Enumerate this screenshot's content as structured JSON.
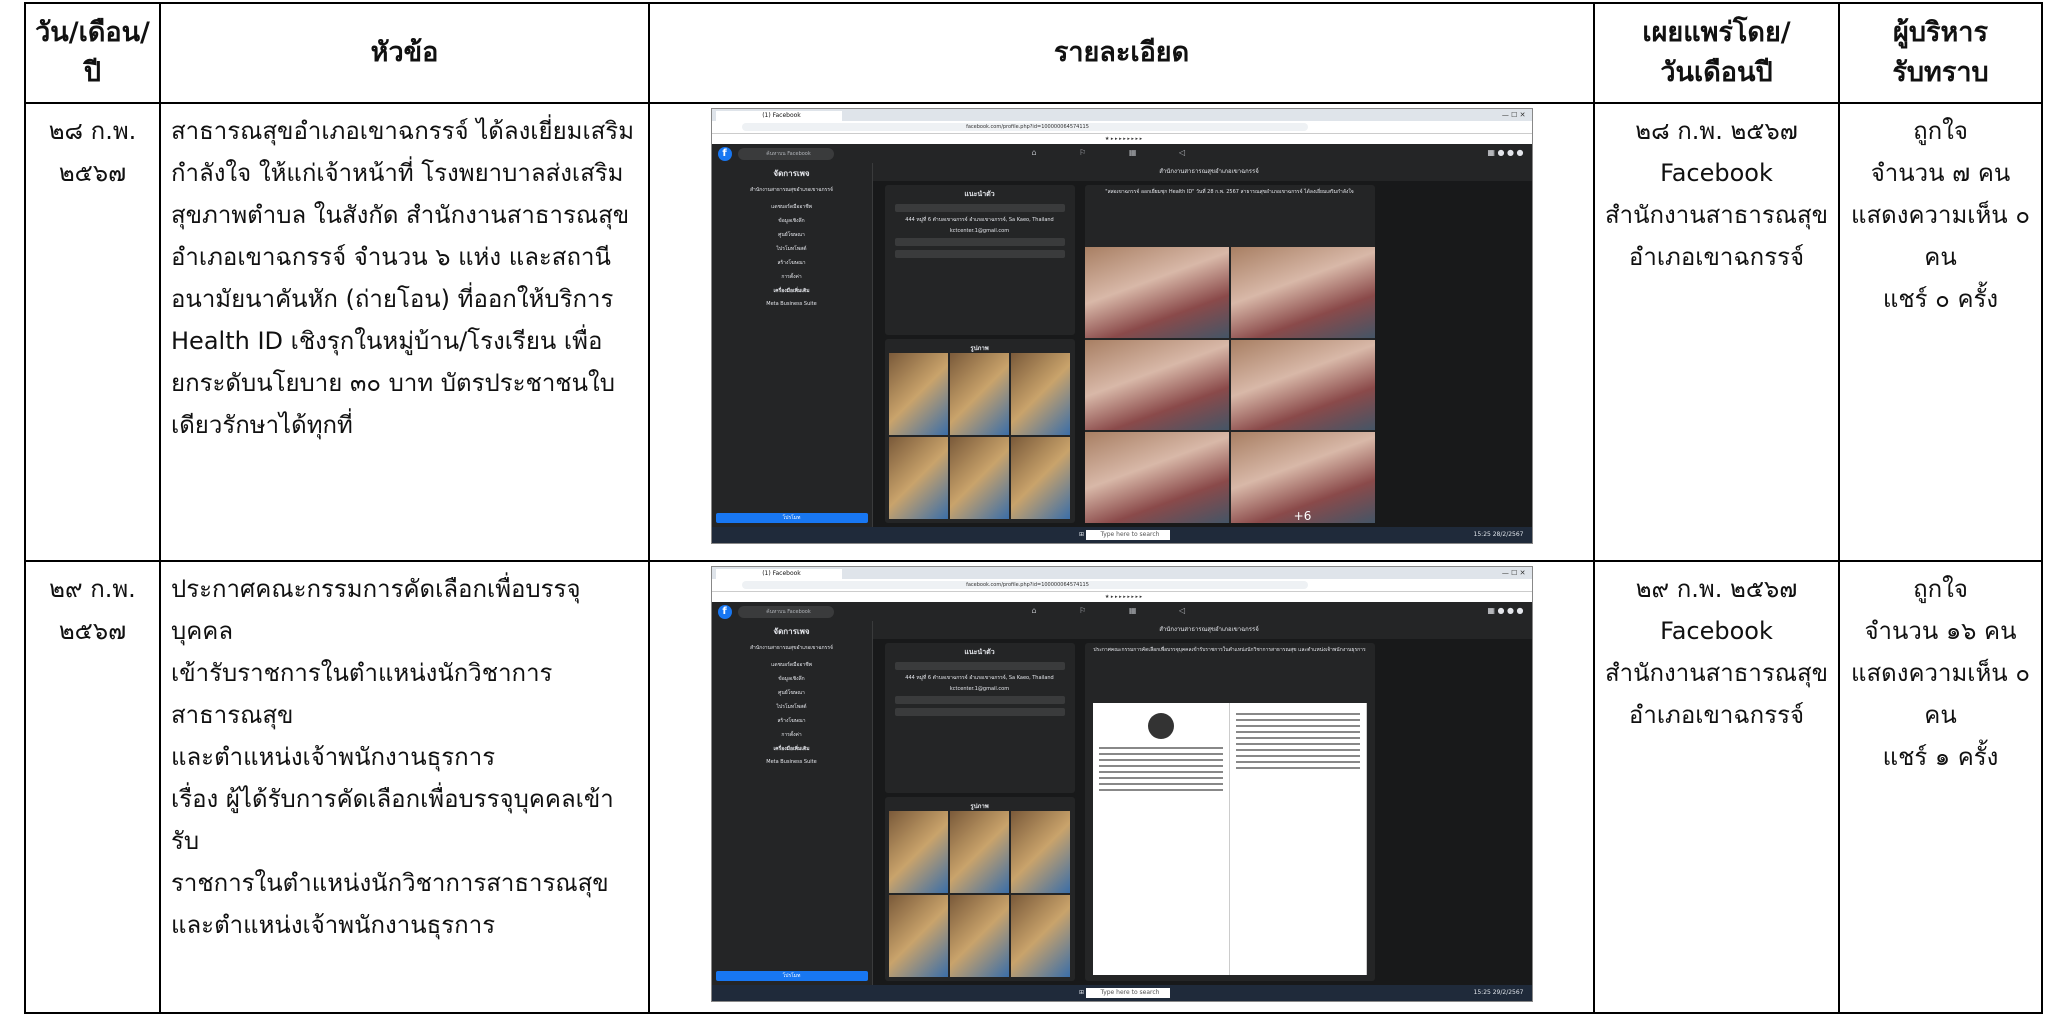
{
  "headers": {
    "date": [
      "วัน/เดือน/",
      "ปี"
    ],
    "topic": "หัวข้อ",
    "detail": "รายละเอียด",
    "publisher": [
      "เผยแพร่โดย/",
      "วันเดือนปี"
    ],
    "exec": [
      "ผู้บริหาร",
      "รับทราบ"
    ]
  },
  "rows": [
    {
      "date": [
        "๒๘ ก.พ.",
        "๒๕๖๗"
      ],
      "topic": [
        "สาธารณสุขอำเภอเขาฉกรรจ์ ได้ลงเยี่ยมเสริม",
        "กำลังใจ ให้แก่เจ้าหน้าที่ โรงพยาบาลส่งเสริม",
        "สุขภาพตำบล ในสังกัด สำนักงานสาธารณสุข",
        "อำเภอเขาฉกรรจ์ จำนวน ๖ แห่ง และสถานี",
        "อนามัยนาคันหัก (ถ่ายโอน) ที่ออกให้บริการ",
        "Health ID  เชิงรุกในหมู่บ้าน/โรงเรียน เพื่อ",
        "ยกระดับนโยบาย ๓๐ บาท บัตรประชาชนใบ",
        "เดียวรักษาได้ทุกที่"
      ],
      "publisher": [
        "๒๘ ก.พ. ๒๕๖๗",
        "Facebook",
        "สำนักงานสาธารณสุข",
        "อำเภอเขาฉกรรจ์"
      ],
      "stats": [
        "ถูกใจ",
        "จำนวน ๗ คน",
        "แสดงความเห็น ๐",
        "คน",
        "แชร์ ๐ ครั้ง"
      ],
      "shot": {
        "tab": "(1) Facebook",
        "url": "facebook.com/profile.php?id=100000064574115",
        "search": "ค้นหาบน Facebook",
        "side_title": "จัดการเพจ",
        "page_name": "สำนักงานสาธารณสุขอำเภอเขาฉกรรจ์",
        "side_items": [
          "แดชบอร์ดมืออาชีพ",
          "ข้อมูลเชิงลึก",
          "ศูนย์โฆษณา",
          "ไปรโมทโพสต์",
          "สร้างโฆษณา",
          "การตั้งค่า"
        ],
        "side_tools": "เครื่องมือเพิ่มเติม",
        "meta_suite": "Meta Business Suite",
        "promote": "โปรโมท",
        "intro_title": "แนะนำตัว",
        "address": "444 หมู่ที่ 6 ตำบลเขาฉกรรจ์ อำเภอเขาฉกรรจ์, Sa Kaeo, Thailand",
        "email": "kctcenter.1@gmail.com",
        "photos_title": "รูปภาพ",
        "post_text": "\"สสอเขาฉกรรจ์ ออกเยี่ยมชุก Health ID\" วันที่ 28 ก.พ. 2567 สาธารณสุขอำเภอเขาฉกรรจ์ ได้ลงเยี่ยมเสริมกำลังใจ",
        "more_count": "+6",
        "taskbar_search": "Type here to search",
        "clock": "15:25 28/2/2567"
      }
    },
    {
      "date": [
        "๒๙ ก.พ.",
        "๒๕๖๗"
      ],
      "topic": [
        "ประกาศคณะกรรมการคัดเลือกเพื่อบรรจุบุคคล",
        "เข้ารับราชการในตำแหน่งนักวิชาการ",
        "สาธารณสุข",
        "และตำแหน่งเจ้าพนักงานธุรการ",
        "เรื่อง ผู้ได้รับการคัดเลือกเพื่อบรรจุบุคคลเข้ารับ",
        "ราชการในตำแหน่งนักวิชาการสาธารณสุข",
        "และตำแหน่งเจ้าพนักงานธุรการ"
      ],
      "publisher": [
        "๒๙ ก.พ. ๒๕๖๗",
        "Facebook",
        "สำนักงานสาธารณสุข",
        "อำเภอเขาฉกรรจ์"
      ],
      "stats": [
        "ถูกใจ",
        "จำนวน ๑๖ คน",
        "แสดงความเห็น ๐",
        "คน",
        "แชร์ ๑ ครั้ง"
      ],
      "shot": {
        "tab": "(1) Facebook",
        "url": "facebook.com/profile.php?id=100000064574115",
        "search": "ค้นหาบน Facebook",
        "side_title": "จัดการเพจ",
        "page_name": "สำนักงานสาธารณสุขอำเภอเขาฉกรรจ์",
        "side_items": [
          "แดชบอร์ดมืออาชีพ",
          "ข้อมูลเชิงลึก",
          "ศูนย์โฆษณา",
          "ไปรโมทโพสต์",
          "สร้างโฆษณา",
          "การตั้งค่า"
        ],
        "side_tools": "เครื่องมือเพิ่มเติม",
        "meta_suite": "Meta Business Suite",
        "promote": "โปรโมท",
        "intro_title": "แนะนำตัว",
        "address": "444 หมู่ที่ 6 ตำบลเขาฉกรรจ์ อำเภอเขาฉกรรจ์, Sa Kaeo, Thailand",
        "email": "kctcenter.1@gmail.com",
        "photos_title": "รูปภาพ",
        "post_text": "ประกาศคณะกรรมการคัดเลือกเพื่อบรรจุบุคคลเข้ารับราชการในตำแหน่งนักวิชาการสาธารณสุข และตำแหน่งเจ้าพนักงานธุรการ",
        "more_count": "",
        "taskbar_search": "Type here to search",
        "clock": "15:25 29/2/2567"
      }
    }
  ]
}
